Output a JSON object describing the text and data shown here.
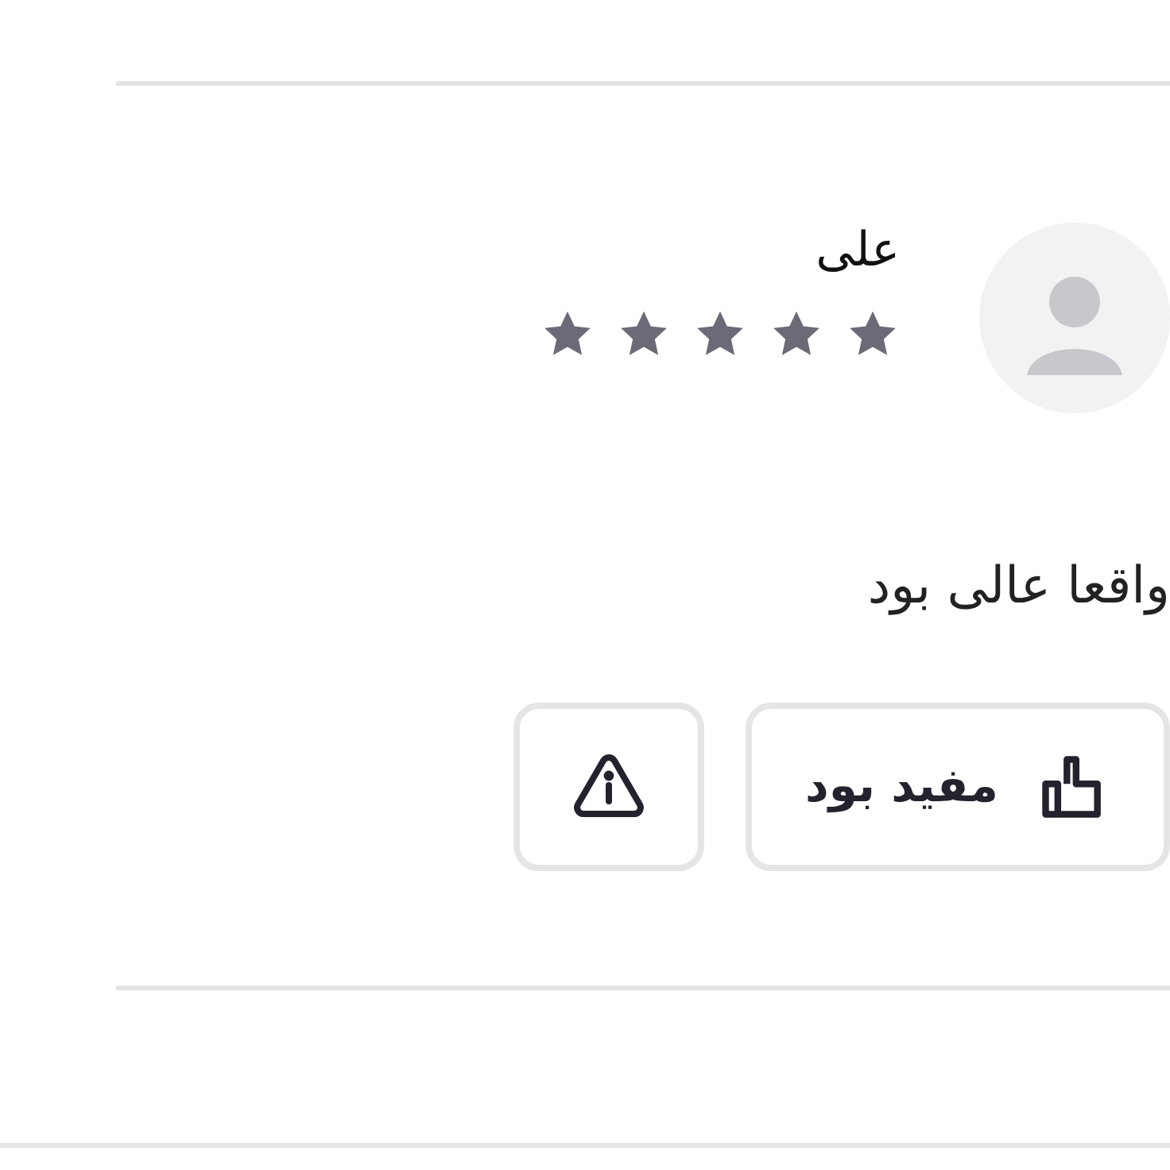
{
  "review": {
    "author": "علی",
    "stars": 5,
    "text": "واقعا عالی بود",
    "helpful_button": "مفید بود"
  }
}
